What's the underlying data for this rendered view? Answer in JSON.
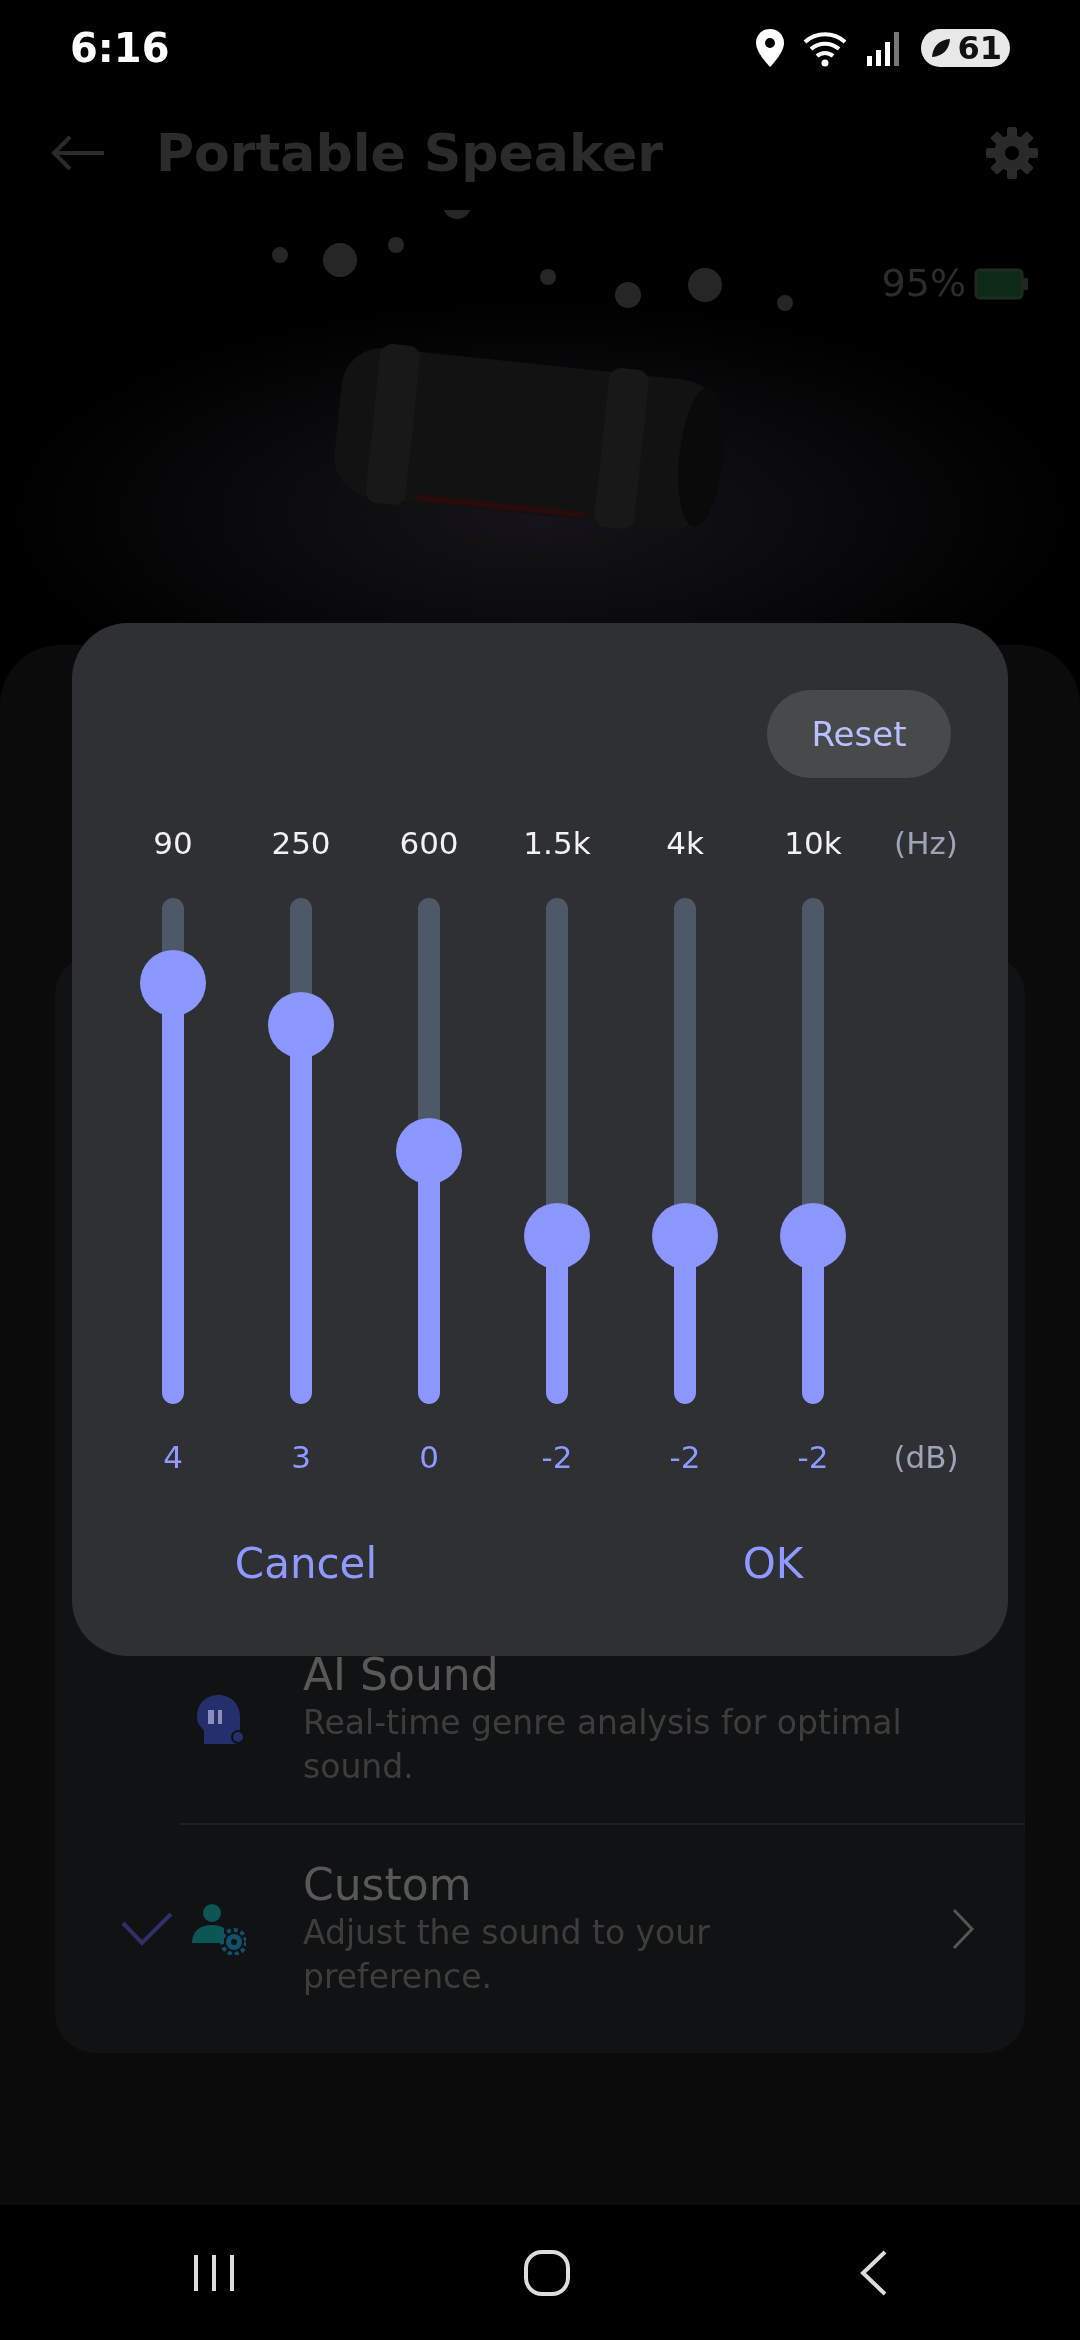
{
  "status_bar": {
    "time": "6:16",
    "battery": "61"
  },
  "header": {
    "title": "Portable Speaker"
  },
  "device": {
    "battery": "95%"
  },
  "modes": [
    {
      "kind": "ai",
      "title": "AI Sound",
      "description": "Real-time genre analysis for optimal sound.",
      "checked": false
    },
    {
      "kind": "custom",
      "title": "Custom",
      "description": "Adjust the sound to your preference.",
      "checked": true
    }
  ],
  "equalizer": {
    "reset": "Reset",
    "freq_unit": "(Hz)",
    "gain_unit": "(dB)",
    "bands": [
      {
        "frequency": "90",
        "gain": "4",
        "level": 0.833
      },
      {
        "frequency": "250",
        "gain": "3",
        "level": 0.75
      },
      {
        "frequency": "600",
        "gain": "0",
        "level": 0.5
      },
      {
        "frequency": "1.5k",
        "gain": "-2",
        "level": 0.333
      },
      {
        "frequency": "4k",
        "gain": "-2",
        "level": 0.333
      },
      {
        "frequency": "10k",
        "gain": "-2",
        "level": 0.333
      }
    ],
    "cancel": "Cancel",
    "ok": "OK"
  }
}
